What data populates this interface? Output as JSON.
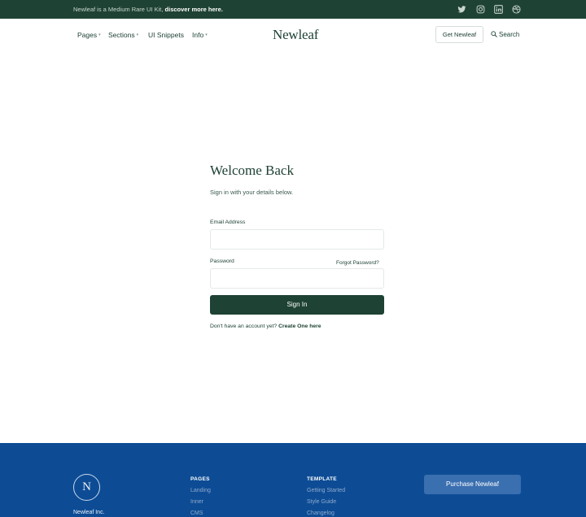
{
  "topbar": {
    "text": "Newleaf is a Medium Rare UI Kit, ",
    "link": "discover more here.",
    "social": [
      "twitter-icon",
      "instagram-icon",
      "linkedin-icon",
      "dribbble-icon"
    ]
  },
  "nav": {
    "items": [
      {
        "label": "Pages",
        "caret": "▾"
      },
      {
        "label": "Sections",
        "caret": "▾"
      },
      {
        "label": "UI Snippets",
        "caret": ""
      },
      {
        "label": "Info",
        "caret": "▾"
      }
    ],
    "brand": "Newleaf",
    "get_button": "Get Newleaf",
    "search": "Search"
  },
  "form": {
    "title": "Welcome Back",
    "subtitle": "Sign in with your details below.",
    "email_label": "Email Address",
    "email_value": "",
    "password_label": "Password",
    "password_value": "",
    "forgot": "Forgot Password?",
    "submit": "Sign In",
    "create_prefix": "Don't have an account yet? ",
    "create_link": "Create One here"
  },
  "footer": {
    "logo_letter": "N",
    "company": "Newleaf Inc.",
    "col1": {
      "heading": "PAGES",
      "links": [
        "Landing",
        "Inner",
        "CMS"
      ]
    },
    "col2": {
      "heading": "TEMPLATE",
      "links": [
        "Getting Started",
        "Style Guide",
        "Changelog"
      ]
    },
    "purchase": "Purchase Newleaf"
  },
  "colors": {
    "primary": "#1e4233",
    "footer": "#0d4c95",
    "footer_button": "#3a6fb0"
  }
}
